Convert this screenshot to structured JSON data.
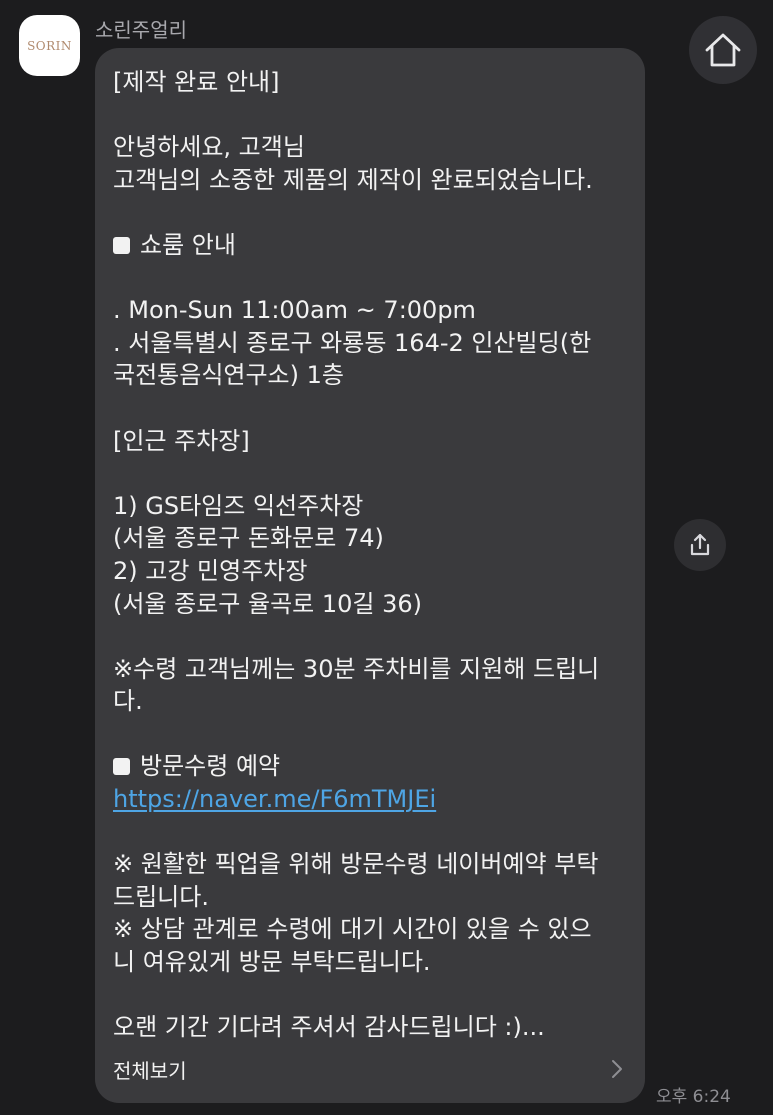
{
  "chat": {
    "sender": {
      "name": "소린주얼리",
      "avatar_text": "SORIN",
      "avatar_icon": "sorin-logo"
    },
    "header": {
      "home_icon": "home-icon"
    },
    "share_icon": "share-icon",
    "message": {
      "title": "[제작 완료 안내]",
      "greeting": "안녕하세요, 고객님",
      "completion": "고객님의 소중한 제품의 제작이 완료되었습니다.",
      "showroom_heading": "쇼룸 안내",
      "hours": ". Mon-Sun 11:00am ~ 7:00pm",
      "address_line1": ". 서울특별시 종로구 와룡동 164-2 인산빌딩(한",
      "address_line2": "국전통음식연구소)  1층",
      "parking_heading": "[인근 주차장]",
      "parking_1_name": "1) GS타임즈 익선주차장",
      "parking_1_address": "(서울 종로구 돈화문로 74)",
      "parking_2_name": "2) 고강 민영주차장",
      "parking_2_address": "(서울 종로구 율곡로 10길 36)",
      "parking_note_line1": "※수령 고객님께는 30분 주차비를 지원해 드립니",
      "parking_note_line2": "다.",
      "reservation_heading": "방문수령 예약",
      "reservation_link": "https://naver.me/F6mTMJEi",
      "note1_line1": "※ 원활한 픽업을 위해 방문수령 네이버예약 부탁",
      "note1_line2": "드립니다.",
      "note2_line1": "※ 상담 관계로 수령에 대기 시간이 있을 수 있으",
      "note2_line2": "니 여유있게 방문 부탁드립니다.",
      "closing": "오랜 기간 기다려 주셔서 감사드립니다 :)...",
      "view_all_label": "전체보기",
      "view_all_icon": "chevron-right-icon"
    },
    "timestamp": "오후 6:24"
  },
  "colors": {
    "background": "#1c1c1e",
    "bubble": "#3a3a3d",
    "text": "#f2f2f2",
    "link": "#4ea5e5",
    "muted": "#8e8e93",
    "brand": "#b08a6e"
  }
}
